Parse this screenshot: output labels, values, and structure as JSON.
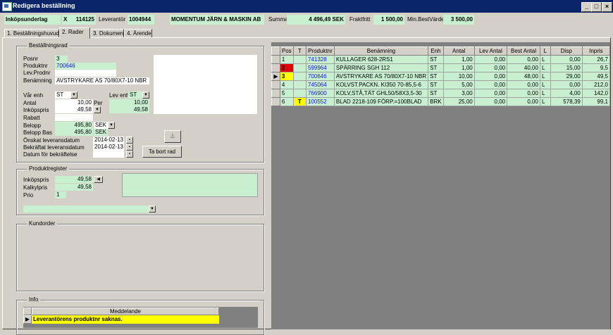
{
  "window": {
    "title": "Redigera beställning"
  },
  "header": {
    "label": "Inköpsunderlag",
    "type_code": "X",
    "order_no": "114125",
    "supplier_label": "Leverantör",
    "supplier_no": "1004944",
    "supplier_name": "MOMENTUM JÄRN & MASKIN AB",
    "sum_label": "Summa",
    "sum_value": "4 496,49 SEK",
    "freight_label": "Fraktfritt",
    "freight_value": "1 500,00",
    "min_label": "Min.BestVärde",
    "min_value": "3 500,00"
  },
  "tabs": [
    {
      "label": "1. Beställningshuvud"
    },
    {
      "label": "2. Rader"
    },
    {
      "label": "3. Dokument"
    },
    {
      "label": "4. Ärende"
    }
  ],
  "orderline": {
    "title": "Beställningsrad",
    "posnr_label": "Posnr",
    "posnr": "3",
    "produktnr_label": "Produktnr",
    "produktnr": "700646",
    "levprodnr_label": "Lev.Prodnr",
    "levprodnr": "",
    "benamning_label": "Benämning",
    "benamning": "AVSTRYKARE AS 70/80X7-10 NBR",
    "varenh_label": "Vår enh",
    "varenh": "ST",
    "levenh_label": "Lev enh",
    "levenh": "ST",
    "antal_label": "Antal",
    "antal": "10,00",
    "per_label": "Per",
    "per": "10,00",
    "inkopspris_label": "Inköpspris",
    "inkopspris": "49,58",
    "inkopspris2": "49,58",
    "rabatt_label": "Rabatt",
    "rabatt": "",
    "belopp_label": "Belopp",
    "belopp": "495,80",
    "currency": "SEK",
    "beloppbas_label": "Belopp Bas",
    "beloppbas": "495,80",
    "currency_bas": "SEK",
    "onskat_label": "Önskat leveransdatum",
    "onskat": "2014-02-13",
    "bekraftat_label": "Bekräftat leveransdatum",
    "bekraftat": "2014-02-13",
    "datumbekr_label": "Datum för bekräftelse",
    "datumbekr": "",
    "delete_btn": "Ta bort rad"
  },
  "product_register": {
    "title": "Produktregister",
    "inkopspris_label": "Inköpspris",
    "inkopspris": "49,58",
    "kalkylpris_label": "Kalkylpris",
    "kalkylpris": "49,58",
    "prio_label": "Prio",
    "prio": "1"
  },
  "customer_orders": {
    "title": "Kundorder"
  },
  "info": {
    "title": "Info",
    "column": "Meddelande",
    "message": "Leverantörens produktnr saknas."
  },
  "grid": {
    "columns": [
      "Pos",
      "T",
      "Produktnr",
      "Benämning",
      "Enh",
      "Antal",
      "Lev Antal",
      "Best Antal",
      "L",
      "Disp",
      "Inpris"
    ],
    "rows": [
      {
        "pos": "1",
        "t": "",
        "produktnr": "741328",
        "benamning": "KULLAGER  628-2RS1",
        "enh": "ST",
        "antal": "1,00",
        "levantal": "0,00",
        "bestantal": "0,00",
        "l": "L",
        "disp": "0,00",
        "inpris": "26,7",
        "pos_color": "",
        "t_color": ""
      },
      {
        "pos": "2",
        "t": "",
        "produktnr": "599964",
        "benamning": "SPÄRRING SGH  112",
        "enh": "ST",
        "antal": "1,00",
        "levantal": "0,00",
        "bestantal": "40,00",
        "l": "L",
        "disp": "15,00",
        "inpris": "9,5",
        "pos_color": "#e00000",
        "t_color": ""
      },
      {
        "pos": "3",
        "t": "",
        "produktnr": "700646",
        "benamning": "AVSTRYKARE AS 70/80X7-10 NBR",
        "enh": "ST",
        "antal": "10,00",
        "levantal": "0,00",
        "bestantal": "48,00",
        "l": "L",
        "disp": "29,00",
        "inpris": "49,5",
        "pos_color": "#ffff00",
        "t_color": ""
      },
      {
        "pos": "4",
        "t": "",
        "produktnr": "745064",
        "benamning": "KOLVST.PACKN. KI350 70-85,5-6",
        "enh": "ST",
        "antal": "5,00",
        "levantal": "0,00",
        "bestantal": "0,00",
        "l": "L",
        "disp": "0,00",
        "inpris": "212,0",
        "pos_color": "",
        "t_color": ""
      },
      {
        "pos": "5",
        "t": "",
        "produktnr": "766900",
        "benamning": "KOLV,STÅ,TÄT GHL50/58X3,5-30",
        "enh": "ST",
        "antal": "3,00",
        "levantal": "0,00",
        "bestantal": "0,00",
        "l": "L",
        "disp": "4,00",
        "inpris": "142,0",
        "pos_color": "",
        "t_color": ""
      },
      {
        "pos": "6",
        "t": "T",
        "produktnr": "100552",
        "benamning": "BLAD 2218-109 FÖRP.=100BLAD",
        "enh": "BRK",
        "antal": "25,00",
        "levantal": "0,00",
        "bestantal": "0,00",
        "l": "L",
        "disp": "578,39",
        "inpris": "99,1",
        "pos_color": "",
        "t_color": "#ffff00"
      }
    ],
    "selected_marker": "▶"
  },
  "icons": {
    "app": "form-icon",
    "minimize": "minimize-icon",
    "maximize": "maximize-icon",
    "close": "close-icon",
    "dropdown": "chevron-down-icon",
    "calendar": "calendar-icon",
    "arrow_left": "arrow-left-icon",
    "filter": "filter-icon",
    "row_selector": "row-pointer-icon"
  },
  "colors": {
    "field_green": "#c8f0d0",
    "title_blue": "#0a246a",
    "link_blue": "#1414c8",
    "msg_yellow": "#ffff00"
  }
}
